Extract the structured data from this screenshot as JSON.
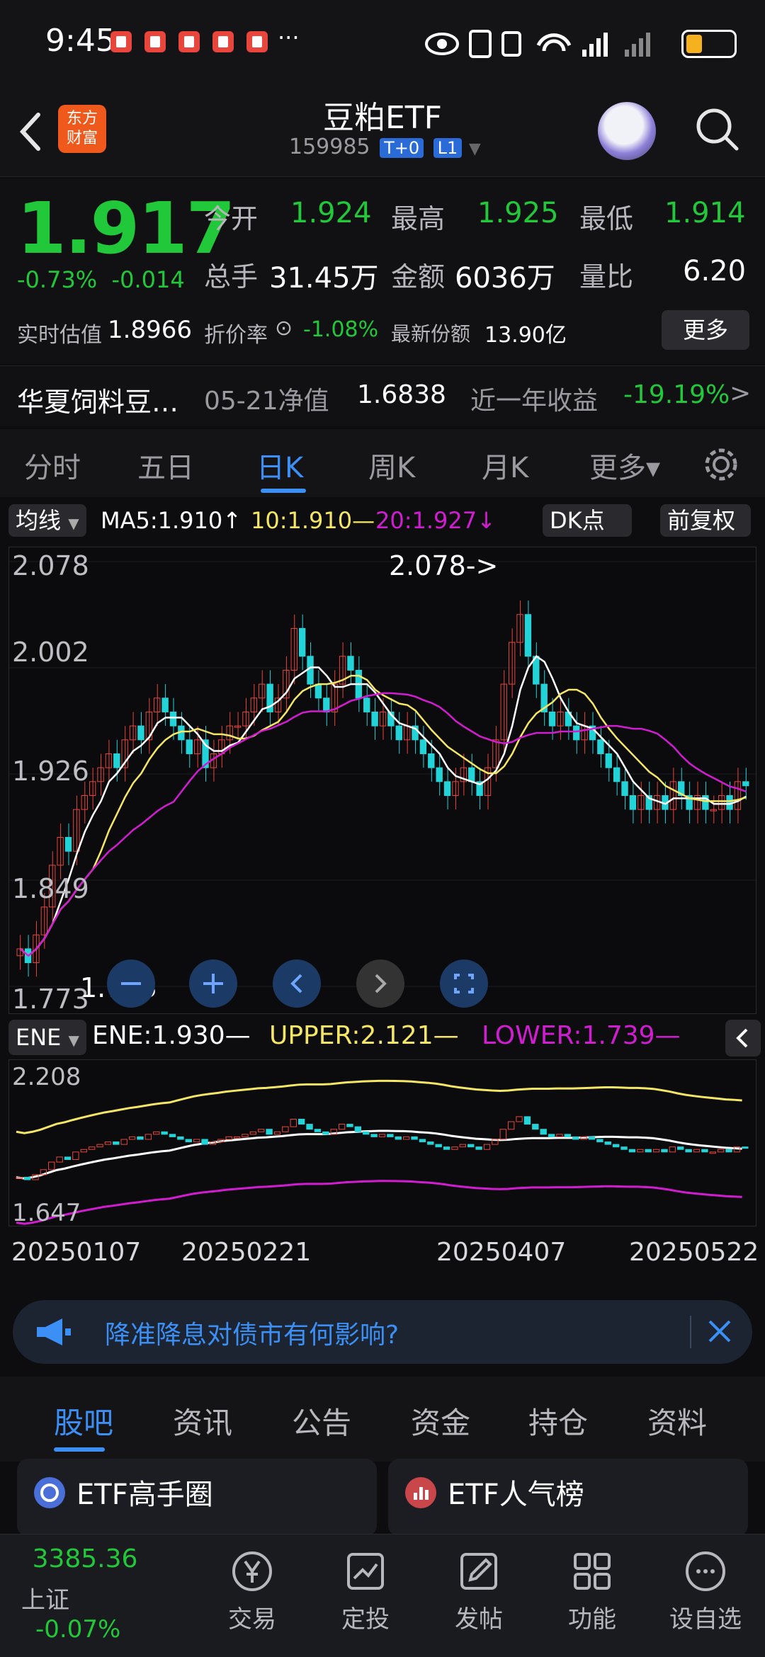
{
  "status": {
    "time": "9:45",
    "more": "···"
  },
  "header": {
    "back_icon": "chevron-left-icon",
    "logo_text_1": "东方",
    "logo_text_2": "财富",
    "title": "豆粕ETF",
    "code": "159985",
    "tag1": "T+0",
    "tag2": "L1"
  },
  "quote": {
    "price": "1.917",
    "change_pct": "-0.73%",
    "change_abs": "-0.014",
    "open_label": "今开",
    "open": "1.924",
    "high_label": "最高",
    "high": "1.925",
    "low_label": "最低",
    "low": "1.914",
    "volume_label": "总手",
    "volume": "31.45万",
    "amount_label": "金额",
    "amount": "6036万",
    "ratio_label": "量比",
    "ratio": "6.20",
    "est_label": "实时估值",
    "est": "1.8966",
    "discount_label": "折价率",
    "discount": "-1.08%",
    "shares_label": "最新份额",
    "shares": "13.90亿",
    "more": "更多"
  },
  "fund": {
    "name": "华夏饲料豆…",
    "nav_label": "05-21净值",
    "nav": "1.6838",
    "ret_label": "近一年收益",
    "ret": "-19.19%",
    "arrow": ">"
  },
  "tabs": [
    "分时",
    "五日",
    "日K",
    "周K",
    "月K",
    "更多▾"
  ],
  "chartbar": {
    "ma_btn": "均线",
    "ma5": "MA5:1.910↑",
    "ma10": "10:1.910—",
    "ma20": "20:1.927↓",
    "dk": "DK点",
    "fq": "前复权"
  },
  "chart_data": [
    {
      "type": "candlestick",
      "ticks": [
        "2.078",
        "2.002",
        "1.926",
        "1.849",
        "1.773"
      ],
      "annotations": [
        "2.078->",
        "1.773"
      ],
      "ylim": [
        1.773,
        2.078
      ],
      "close": [
        1.8,
        1.79,
        1.81,
        1.83,
        1.86,
        1.88,
        1.87,
        1.9,
        1.91,
        1.92,
        1.93,
        1.94,
        1.93,
        1.95,
        1.96,
        1.95,
        1.97,
        1.98,
        1.97,
        1.96,
        1.95,
        1.94,
        1.95,
        1.93,
        1.94,
        1.95,
        1.96,
        1.96,
        1.97,
        1.98,
        1.99,
        1.97,
        1.98,
        2.0,
        2.03,
        2.01,
        1.99,
        1.98,
        1.97,
        1.99,
        2.01,
        2.0,
        1.98,
        1.97,
        1.96,
        1.97,
        1.96,
        1.95,
        1.96,
        1.95,
        1.94,
        1.93,
        1.92,
        1.91,
        1.92,
        1.93,
        1.92,
        1.91,
        1.93,
        1.95,
        1.99,
        2.02,
        2.04,
        2.01,
        1.99,
        1.97,
        1.96,
        1.97,
        1.96,
        1.95,
        1.96,
        1.95,
        1.94,
        1.93,
        1.92,
        1.91,
        1.9,
        1.91,
        1.9,
        1.91,
        1.9,
        1.92,
        1.91,
        1.9,
        1.91,
        1.9,
        1.9,
        1.91,
        1.9,
        1.92,
        1.917
      ],
      "ma5_color": "#ffffff",
      "ma10_color": "#f5e663",
      "ma20_color": "#d21cd2"
    },
    {
      "type": "line",
      "ene": "ENE:1.930—",
      "upper": "UPPER:2.121—",
      "lower": "LOWER:1.739—",
      "ticks": [
        "2.208",
        "1.647"
      ],
      "ylim": [
        1.647,
        2.208
      ]
    }
  ],
  "dates": [
    "20250107",
    "20250221",
    "20250407",
    "20250522"
  ],
  "controls": [
    "minus-icon",
    "plus-icon",
    "chevron-left-icon",
    "chevron-right-icon",
    "expand-icon"
  ],
  "banner": {
    "text": "降准降息对债市有何影响?"
  },
  "subtabs": [
    "股吧",
    "资讯",
    "公告",
    "资金",
    "持仓",
    "资料"
  ],
  "cards": {
    "left": "ETF高手圈",
    "right": "ETF人气榜"
  },
  "bottom": {
    "index_value": "3385.36",
    "index_name": "上证",
    "index_change": "-0.07%",
    "items": [
      "交易",
      "定投",
      "发帖",
      "功能",
      "设自选"
    ]
  }
}
